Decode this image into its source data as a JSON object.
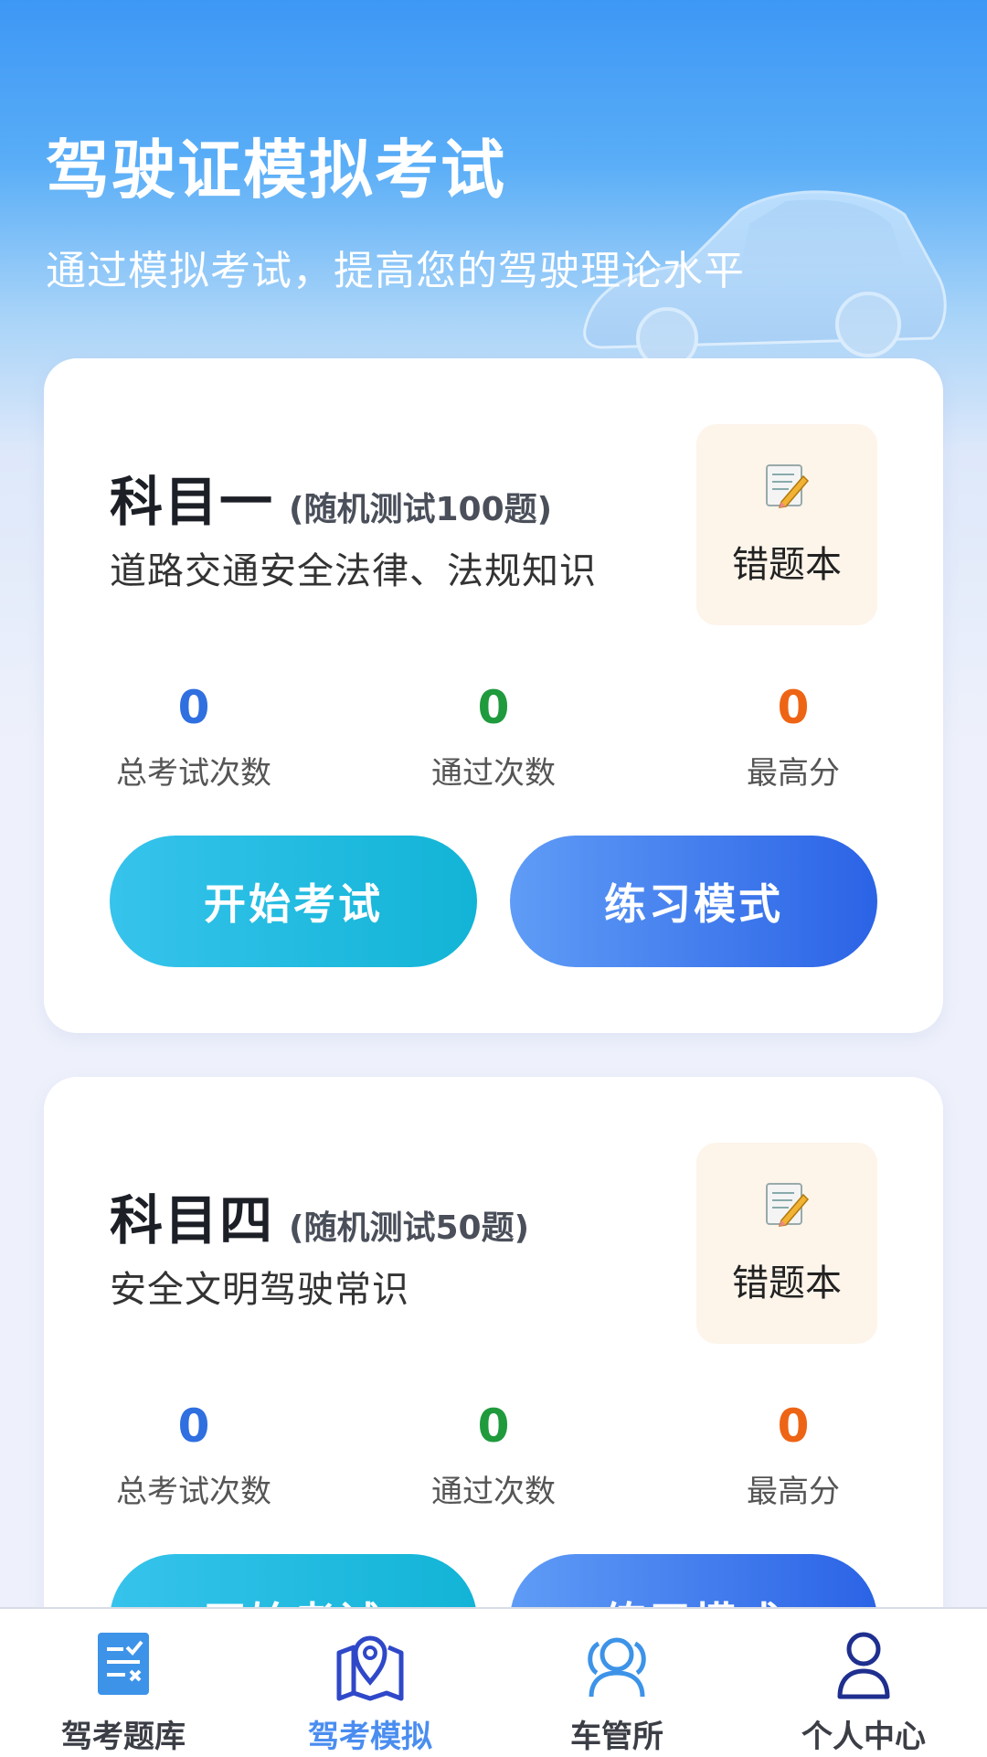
{
  "hero": {
    "title": "驾驶证模拟考试",
    "subtitle": "通过模拟考试，提高您的驾驶理论水平"
  },
  "subjects": [
    {
      "name": "科目一",
      "count": "(随机测试100题)",
      "desc": "道路交通安全法律、法规知识",
      "wrong_book": "错题本",
      "stats": [
        {
          "value": "0",
          "label": "总考试次数"
        },
        {
          "value": "0",
          "label": "通过次数"
        },
        {
          "value": "0",
          "label": "最高分"
        }
      ],
      "start_label": "开始考试",
      "practice_label": "练习模式"
    },
    {
      "name": "科目四",
      "count": "(随机测试50题)",
      "desc": "安全文明驾驶常识",
      "wrong_book": "错题本",
      "stats": [
        {
          "value": "0",
          "label": "总考试次数"
        },
        {
          "value": "0",
          "label": "通过次数"
        },
        {
          "value": "0",
          "label": "最高分"
        }
      ],
      "start_label": "开始考试",
      "practice_label": "练习模式"
    }
  ],
  "tabbar": {
    "items": [
      {
        "label": "驾考题库",
        "icon": "question-bank-icon"
      },
      {
        "label": "驾考模拟",
        "icon": "map-location-icon",
        "active": true
      },
      {
        "label": "车管所",
        "icon": "people-group-icon"
      },
      {
        "label": "个人中心",
        "icon": "person-icon"
      }
    ]
  },
  "colors": {
    "accent": "#4a8df0",
    "stat_total": "#2f6fe0",
    "stat_pass": "#1f9a3d",
    "stat_best": "#ee6415"
  }
}
